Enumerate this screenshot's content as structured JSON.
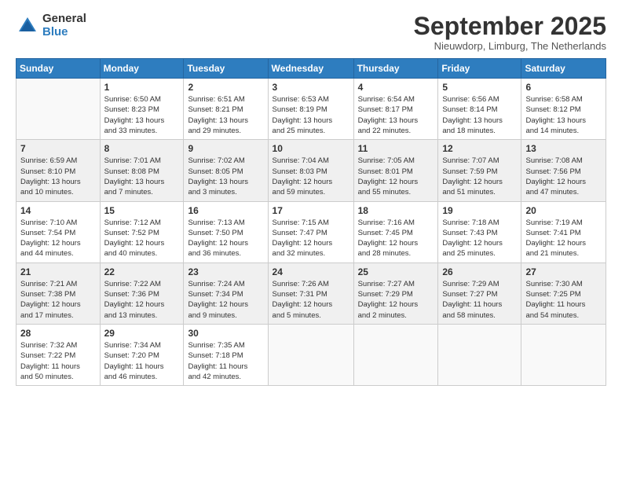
{
  "logo": {
    "general": "General",
    "blue": "Blue"
  },
  "title": "September 2025",
  "subtitle": "Nieuwdorp, Limburg, The Netherlands",
  "header_days": [
    "Sunday",
    "Monday",
    "Tuesday",
    "Wednesday",
    "Thursday",
    "Friday",
    "Saturday"
  ],
  "weeks": [
    [
      {
        "day": "",
        "info": ""
      },
      {
        "day": "1",
        "info": "Sunrise: 6:50 AM\nSunset: 8:23 PM\nDaylight: 13 hours\nand 33 minutes."
      },
      {
        "day": "2",
        "info": "Sunrise: 6:51 AM\nSunset: 8:21 PM\nDaylight: 13 hours\nand 29 minutes."
      },
      {
        "day": "3",
        "info": "Sunrise: 6:53 AM\nSunset: 8:19 PM\nDaylight: 13 hours\nand 25 minutes."
      },
      {
        "day": "4",
        "info": "Sunrise: 6:54 AM\nSunset: 8:17 PM\nDaylight: 13 hours\nand 22 minutes."
      },
      {
        "day": "5",
        "info": "Sunrise: 6:56 AM\nSunset: 8:14 PM\nDaylight: 13 hours\nand 18 minutes."
      },
      {
        "day": "6",
        "info": "Sunrise: 6:58 AM\nSunset: 8:12 PM\nDaylight: 13 hours\nand 14 minutes."
      }
    ],
    [
      {
        "day": "7",
        "info": "Sunrise: 6:59 AM\nSunset: 8:10 PM\nDaylight: 13 hours\nand 10 minutes."
      },
      {
        "day": "8",
        "info": "Sunrise: 7:01 AM\nSunset: 8:08 PM\nDaylight: 13 hours\nand 7 minutes."
      },
      {
        "day": "9",
        "info": "Sunrise: 7:02 AM\nSunset: 8:05 PM\nDaylight: 13 hours\nand 3 minutes."
      },
      {
        "day": "10",
        "info": "Sunrise: 7:04 AM\nSunset: 8:03 PM\nDaylight: 12 hours\nand 59 minutes."
      },
      {
        "day": "11",
        "info": "Sunrise: 7:05 AM\nSunset: 8:01 PM\nDaylight: 12 hours\nand 55 minutes."
      },
      {
        "day": "12",
        "info": "Sunrise: 7:07 AM\nSunset: 7:59 PM\nDaylight: 12 hours\nand 51 minutes."
      },
      {
        "day": "13",
        "info": "Sunrise: 7:08 AM\nSunset: 7:56 PM\nDaylight: 12 hours\nand 47 minutes."
      }
    ],
    [
      {
        "day": "14",
        "info": "Sunrise: 7:10 AM\nSunset: 7:54 PM\nDaylight: 12 hours\nand 44 minutes."
      },
      {
        "day": "15",
        "info": "Sunrise: 7:12 AM\nSunset: 7:52 PM\nDaylight: 12 hours\nand 40 minutes."
      },
      {
        "day": "16",
        "info": "Sunrise: 7:13 AM\nSunset: 7:50 PM\nDaylight: 12 hours\nand 36 minutes."
      },
      {
        "day": "17",
        "info": "Sunrise: 7:15 AM\nSunset: 7:47 PM\nDaylight: 12 hours\nand 32 minutes."
      },
      {
        "day": "18",
        "info": "Sunrise: 7:16 AM\nSunset: 7:45 PM\nDaylight: 12 hours\nand 28 minutes."
      },
      {
        "day": "19",
        "info": "Sunrise: 7:18 AM\nSunset: 7:43 PM\nDaylight: 12 hours\nand 25 minutes."
      },
      {
        "day": "20",
        "info": "Sunrise: 7:19 AM\nSunset: 7:41 PM\nDaylight: 12 hours\nand 21 minutes."
      }
    ],
    [
      {
        "day": "21",
        "info": "Sunrise: 7:21 AM\nSunset: 7:38 PM\nDaylight: 12 hours\nand 17 minutes."
      },
      {
        "day": "22",
        "info": "Sunrise: 7:22 AM\nSunset: 7:36 PM\nDaylight: 12 hours\nand 13 minutes."
      },
      {
        "day": "23",
        "info": "Sunrise: 7:24 AM\nSunset: 7:34 PM\nDaylight: 12 hours\nand 9 minutes."
      },
      {
        "day": "24",
        "info": "Sunrise: 7:26 AM\nSunset: 7:31 PM\nDaylight: 12 hours\nand 5 minutes."
      },
      {
        "day": "25",
        "info": "Sunrise: 7:27 AM\nSunset: 7:29 PM\nDaylight: 12 hours\nand 2 minutes."
      },
      {
        "day": "26",
        "info": "Sunrise: 7:29 AM\nSunset: 7:27 PM\nDaylight: 11 hours\nand 58 minutes."
      },
      {
        "day": "27",
        "info": "Sunrise: 7:30 AM\nSunset: 7:25 PM\nDaylight: 11 hours\nand 54 minutes."
      }
    ],
    [
      {
        "day": "28",
        "info": "Sunrise: 7:32 AM\nSunset: 7:22 PM\nDaylight: 11 hours\nand 50 minutes."
      },
      {
        "day": "29",
        "info": "Sunrise: 7:34 AM\nSunset: 7:20 PM\nDaylight: 11 hours\nand 46 minutes."
      },
      {
        "day": "30",
        "info": "Sunrise: 7:35 AM\nSunset: 7:18 PM\nDaylight: 11 hours\nand 42 minutes."
      },
      {
        "day": "",
        "info": ""
      },
      {
        "day": "",
        "info": ""
      },
      {
        "day": "",
        "info": ""
      },
      {
        "day": "",
        "info": ""
      }
    ]
  ]
}
